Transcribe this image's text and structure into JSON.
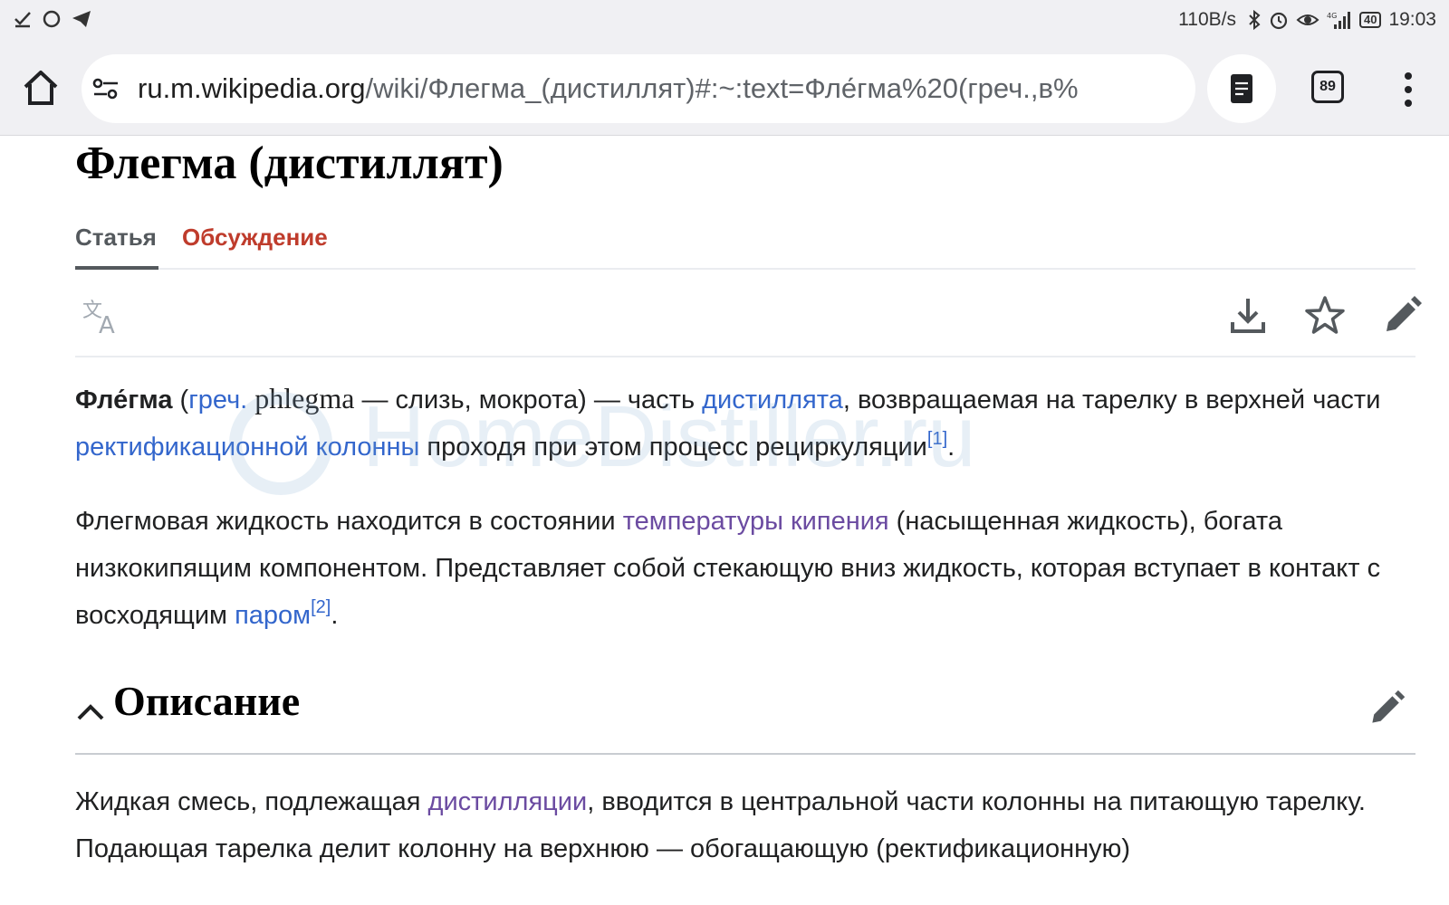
{
  "status_bar": {
    "net_speed": "110B/s",
    "battery": "40",
    "time": "19:03"
  },
  "browser": {
    "url_host": "ru.m.wikipedia.org",
    "url_path": "/wiki/Флегма_(дистиллят)#:~:text=Фле́гма%20(греч.,в%",
    "tab_count": "89"
  },
  "article": {
    "title": "Флегма (дистиллят)",
    "tabs": {
      "article": "Статья",
      "talk": "Обсуждение"
    },
    "p1": {
      "term": "Фле́гма",
      "open_paren": " (",
      "lang_link": "греч.",
      "greek": " phlegma",
      "gloss": " — слизь, мокрота) — часть ",
      "link1": "дистиллята",
      "text2": ", возвращаемая на тарелку в верхней части ",
      "link2": "ректификационной колонны",
      "text3": " проходя при этом процесс рециркуляции",
      "ref": "[1]",
      "end": "."
    },
    "p2": {
      "text1": "Флегмовая жидкость находится в состоянии ",
      "link1": "температуры кипения",
      "text2": " (насыщенная жидкость), богата низкокипящим компонентом. Представляет собой стекающую вниз жидкость, которая вступает в контакт с восходящим ",
      "link2": "паром",
      "ref": "[2]",
      "end": "."
    },
    "section": {
      "title": "Описание"
    },
    "p3": {
      "text1": "Жидкая смесь, подлежащая ",
      "link1": "дистилляции",
      "text2": ", вводится в центральной части колонны на питающую тарелку. Подающая тарелка делит колонну на верхнюю — обогащающую (ректификационную)"
    }
  },
  "watermark": {
    "text": "HomeDistiller.ru"
  },
  "icons": {
    "status_left": [
      "check-icon",
      "sync-icon",
      "telegram-icon"
    ],
    "status_right": [
      "bluetooth-icon",
      "alarm-icon",
      "eye-icon",
      "signal-icon",
      "battery-icon"
    ],
    "toolbar": [
      "translate-icon",
      "download-icon",
      "star-icon",
      "edit-icon"
    ]
  },
  "colors": {
    "link": "#3366cc",
    "visited_link": "#6b4ba1",
    "talk_tab": "#bf3c2c",
    "chrome_bg": "#f0f0f3"
  }
}
